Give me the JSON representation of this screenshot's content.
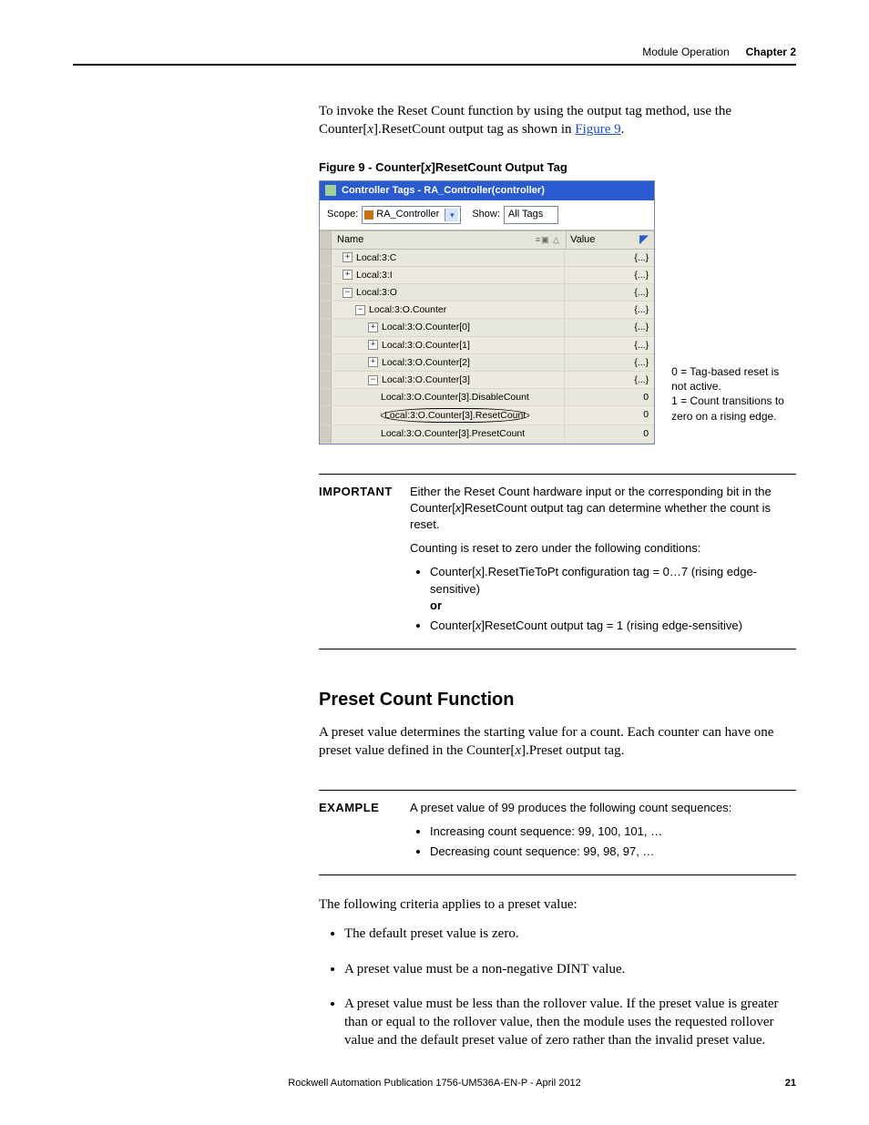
{
  "header": {
    "topic": "Module Operation",
    "chapter": "Chapter 2"
  },
  "intro": {
    "line1": "To invoke the Reset Count function by using the output tag method, use the Counter[",
    "xi": "x",
    "line2": "].ResetCount output tag as shown in ",
    "link": "Figure 9",
    "period": "."
  },
  "figure": {
    "caption_prefix": "Figure 9 - Counter[",
    "caption_x": "x",
    "caption_suffix": "]ResetCount Output Tag"
  },
  "tagwin": {
    "title": "Controller Tags - RA_Controller(controller)",
    "scope_label": "Scope:",
    "scope_value": "RA_Controller",
    "show_label": "Show:",
    "show_value": "All Tags",
    "col_name": "Name",
    "sort_glyphs": "≡▣ △",
    "col_value": "Value",
    "rows": [
      {
        "pm": "+",
        "name": "Local:3:C",
        "val": "{...}",
        "ind": "ind1"
      },
      {
        "pm": "+",
        "name": "Local:3:I",
        "val": "{...}",
        "ind": "ind1"
      },
      {
        "pm": "−",
        "name": "Local:3:O",
        "val": "{...}",
        "ind": "ind1"
      },
      {
        "pm": "−",
        "name": "Local:3:O.Counter",
        "val": "{...}",
        "ind": "ind2"
      },
      {
        "pm": "+",
        "name": "Local:3:O.Counter[0]",
        "val": "{...}",
        "ind": "ind3"
      },
      {
        "pm": "+",
        "name": "Local:3:O.Counter[1]",
        "val": "{...}",
        "ind": "ind3"
      },
      {
        "pm": "+",
        "name": "Local:3:O.Counter[2]",
        "val": "{...}",
        "ind": "ind3"
      },
      {
        "pm": "−",
        "name": "Local:3:O.Counter[3]",
        "val": "{...}",
        "ind": "ind3"
      },
      {
        "pm": "",
        "name": "Local:3:O.Counter[3].DisableCount",
        "val": "0",
        "ind": "ind4"
      },
      {
        "pm": "",
        "name": "Local:3:O.Counter[3].ResetCount",
        "val": "0",
        "ind": "ind4",
        "oval": true
      },
      {
        "pm": "",
        "name": "Local:3:O.Counter[3].PresetCount",
        "val": "0",
        "ind": "ind4"
      }
    ]
  },
  "callout": {
    "l1": "0 = Tag-based reset is not active.",
    "l2": "1 = Count transitions to zero on a rising edge."
  },
  "important": {
    "label": "IMPORTANT",
    "p1a": "Either the Reset Count hardware input or the corresponding bit in the Counter[",
    "p1x": "x",
    "p1b": "]ResetCount output tag can determine whether the count is reset.",
    "p2": "Counting is reset to zero under the following conditions:",
    "b1": "Counter[x].ResetTieToPt configuration tag = 0…7 (rising edge-sensitive)",
    "or": "or",
    "b2a": "Counter[",
    "b2x": "x",
    "b2b": "]ResetCount output tag = 1 (rising edge-sensitive)"
  },
  "section": {
    "heading": "Preset Count Function",
    "p1a": "A preset value determines the starting value for a count. Each counter can have one preset value defined in the Counter[",
    "p1x": "x",
    "p1b": "].Preset output tag."
  },
  "example": {
    "label": "EXAMPLE",
    "lead": "A preset value of 99 produces the following count sequences:",
    "b1": "Increasing count sequence: 99, 100, 101, …",
    "b2": "Decreasing count sequence: 99, 98, 97, …"
  },
  "criteria": {
    "lead": "The following criteria applies to a preset value:",
    "b1": "The default preset value is zero.",
    "b2": "A preset value must be a non-negative DINT value.",
    "b3": "A preset value must be less than the rollover value. If the preset value is greater than or equal to the rollover value, then the module uses the requested rollover value and the default preset value of zero rather than the invalid preset value."
  },
  "footer": {
    "pub": "Rockwell Automation Publication 1756-UM536A-EN-P - April 2012",
    "page": "21"
  }
}
